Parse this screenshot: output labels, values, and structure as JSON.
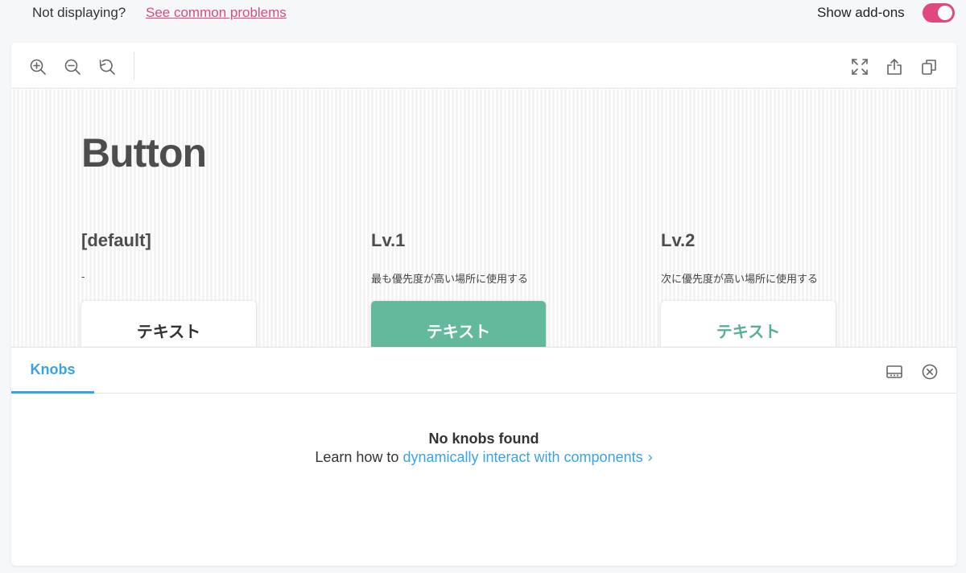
{
  "topbar": {
    "not_displaying_text": "Not displaying?",
    "problems_link": "See common problems",
    "show_addons_label": "Show add-ons",
    "show_addons_enabled": true
  },
  "toolbar": {
    "left_icons": [
      "zoom-in-icon",
      "zoom-out-icon",
      "reset-zoom-icon"
    ],
    "right_icons": [
      "fullscreen-icon",
      "share-icon",
      "copy-icon"
    ]
  },
  "story": {
    "title": "Button",
    "variants": [
      {
        "heading": "[default]",
        "description": "-",
        "button_label": "テキスト",
        "style": "default"
      },
      {
        "heading": "Lv.1",
        "description": "最も優先度が高い場所に使用する",
        "button_label": "テキスト",
        "style": "primary"
      },
      {
        "heading": "Lv.2",
        "description": "次に優先度が高い場所に使用する",
        "button_label": "テキスト",
        "style": "secondary"
      }
    ]
  },
  "addons": {
    "tabs": [
      {
        "label": "Knobs",
        "active": true
      }
    ],
    "panel_icons": [
      "panel-layout-icon",
      "close-circle-icon"
    ],
    "empty_title": "No knobs found",
    "empty_prefix": "Learn how to",
    "empty_link": "dynamically interact with components",
    "empty_chevron": "›"
  },
  "colors": {
    "accent_pink": "#e0487f",
    "accent_blue": "#3aa3e3",
    "button_green": "#63b99b",
    "text_green": "#57b08f"
  }
}
